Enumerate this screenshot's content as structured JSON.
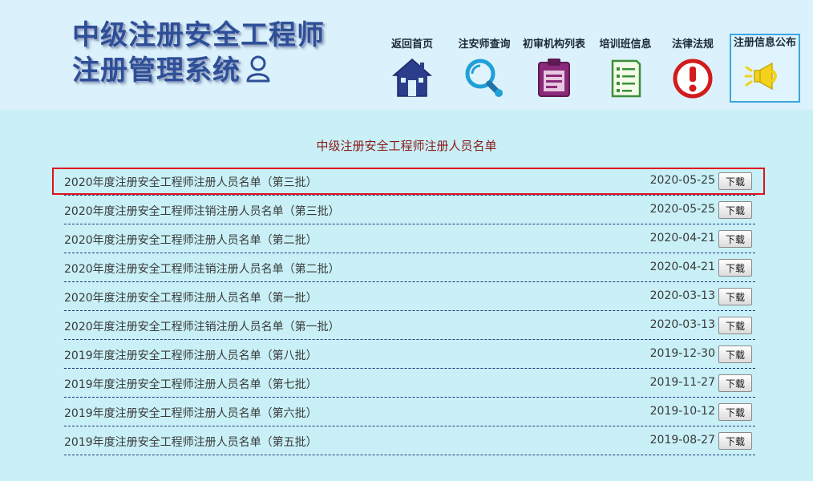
{
  "header": {
    "logo_line1": "中级注册安全工程师",
    "logo_line2": "注册管理系统",
    "nav": [
      {
        "label": "返回首页",
        "icon": "home-icon"
      },
      {
        "label": "注安师查询",
        "icon": "magnifier-icon"
      },
      {
        "label": "初审机构列表",
        "icon": "clipboard-icon"
      },
      {
        "label": "培训班信息",
        "icon": "checklist-icon"
      },
      {
        "label": "法律法规",
        "icon": "alert-icon"
      },
      {
        "label": "注册信息公布",
        "icon": "megaphone-icon",
        "active": true
      }
    ]
  },
  "main": {
    "title": "中级注册安全工程师注册人员名单",
    "download_label": "下载",
    "rows": [
      {
        "title": "2020年度注册安全工程师注册人员名单（第三批）",
        "date": "2020-05-25"
      },
      {
        "title": "2020年度注册安全工程师注销注册人员名单（第三批）",
        "date": "2020-05-25"
      },
      {
        "title": "2020年度注册安全工程师注册人员名单（第二批）",
        "date": "2020-04-21"
      },
      {
        "title": "2020年度注册安全工程师注销注册人员名单（第二批）",
        "date": "2020-04-21"
      },
      {
        "title": "2020年度注册安全工程师注册人员名单（第一批）",
        "date": "2020-03-13"
      },
      {
        "title": "2020年度注册安全工程师注销注册人员名单（第一批）",
        "date": "2020-03-13"
      },
      {
        "title": "2019年度注册安全工程师注册人员名单（第八批）",
        "date": "2019-12-30"
      },
      {
        "title": "2019年度注册安全工程师注册人员名单（第七批）",
        "date": "2019-11-27"
      },
      {
        "title": "2019年度注册安全工程师注册人员名单（第六批）",
        "date": "2019-10-12"
      },
      {
        "title": "2019年度注册安全工程师注册人员名单（第五批）",
        "date": "2019-08-27"
      }
    ]
  },
  "colors": {
    "page_bg": "#c8f0f6",
    "header_bg": "#dbf1fb",
    "logo_text": "#2e4f97",
    "title_text": "#8b1a1a",
    "highlight_border": "#e0121f",
    "active_nav_border": "#3aa7e0"
  }
}
